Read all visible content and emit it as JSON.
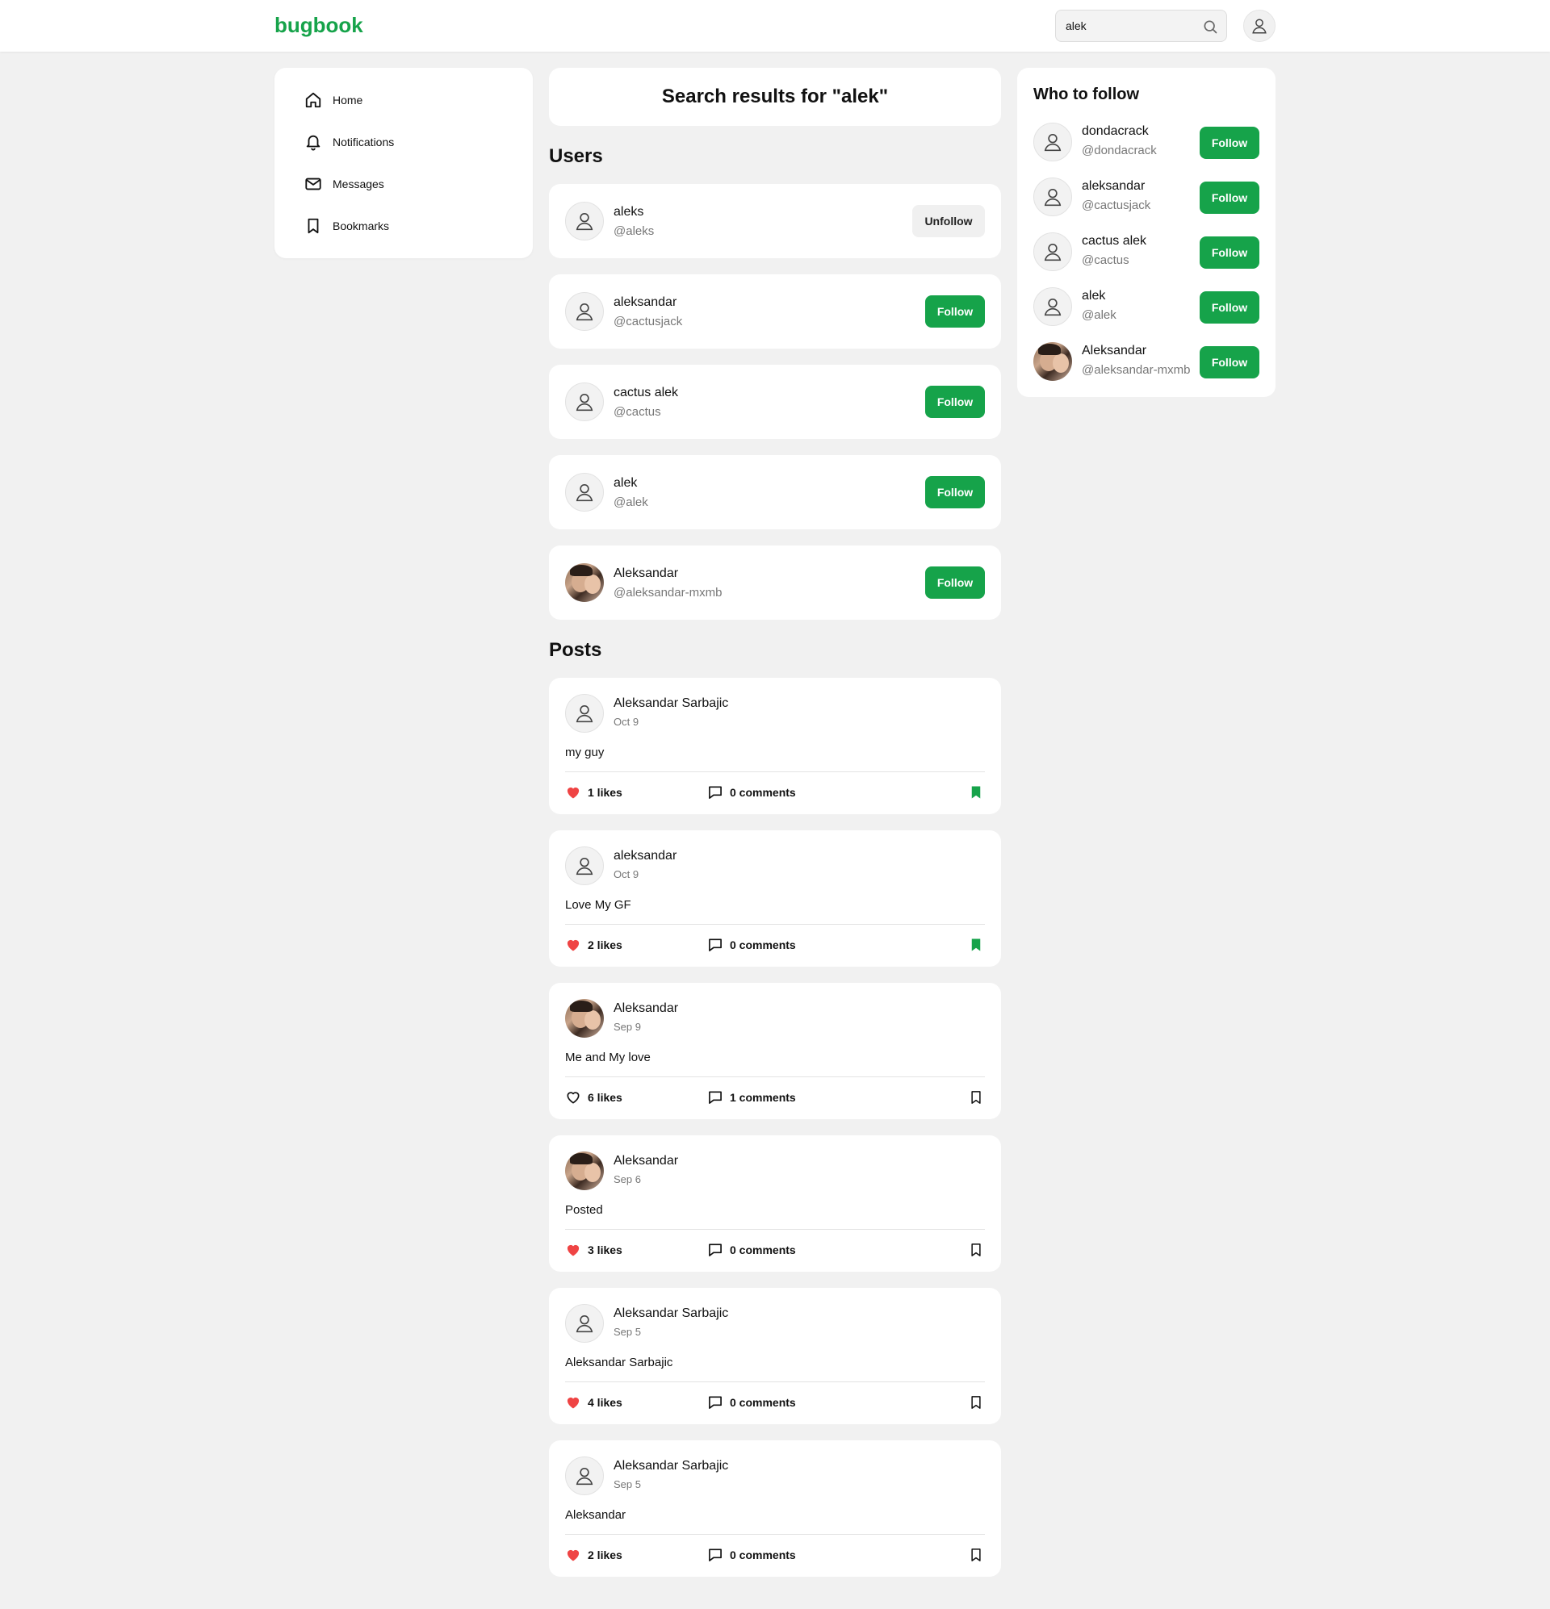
{
  "header": {
    "logo": "bugbook",
    "search_value": "alek",
    "search_icon": "search-icon",
    "avatar_icon": "user-icon"
  },
  "sidebar": {
    "items": [
      {
        "label": "Home",
        "icon": "home-icon"
      },
      {
        "label": "Notifications",
        "icon": "bell-icon"
      },
      {
        "label": "Messages",
        "icon": "mail-icon"
      },
      {
        "label": "Bookmarks",
        "icon": "bookmark-icon"
      }
    ]
  },
  "main": {
    "title": "Search results for \"alek\"",
    "users_heading": "Users",
    "posts_heading": "Posts",
    "users": [
      {
        "name": "aleks",
        "handle": "@aleks",
        "button": "Unfollow",
        "photo": false
      },
      {
        "name": "aleksandar",
        "handle": "@cactusjack",
        "button": "Follow",
        "photo": false
      },
      {
        "name": "cactus alek",
        "handle": "@cactus",
        "button": "Follow",
        "photo": false
      },
      {
        "name": "alek",
        "handle": "@alek",
        "button": "Follow",
        "photo": false
      },
      {
        "name": "Aleksandar",
        "handle": "@aleksandar-mxmb",
        "button": "Follow",
        "photo": true
      }
    ],
    "posts": [
      {
        "author": "Aleksandar Sarbajic",
        "date": "Oct 9",
        "body": "my guy",
        "likes": "1 likes",
        "liked": true,
        "comments": "0 comments",
        "bookmarked": true,
        "photo": false
      },
      {
        "author": "aleksandar",
        "date": "Oct 9",
        "body": "Love My GF",
        "likes": "2 likes",
        "liked": true,
        "comments": "0 comments",
        "bookmarked": true,
        "photo": false
      },
      {
        "author": "Aleksandar",
        "date": "Sep 9",
        "body": "Me and My love",
        "likes": "6 likes",
        "liked": false,
        "comments": "1 comments",
        "bookmarked": false,
        "photo": true
      },
      {
        "author": "Aleksandar",
        "date": "Sep 6",
        "body": "Posted",
        "likes": "3 likes",
        "liked": true,
        "comments": "0 comments",
        "bookmarked": false,
        "photo": true
      },
      {
        "author": "Aleksandar Sarbajic",
        "date": "Sep 5",
        "body": "Aleksandar Sarbajic",
        "likes": "4 likes",
        "liked": true,
        "comments": "0 comments",
        "bookmarked": false,
        "photo": false
      },
      {
        "author": "Aleksandar Sarbajic",
        "date": "Sep 5",
        "body": "Aleksandar",
        "likes": "2 likes",
        "liked": true,
        "comments": "0 comments",
        "bookmarked": false,
        "photo": false
      }
    ]
  },
  "who_to_follow": {
    "title": "Who to follow",
    "users": [
      {
        "name": "dondacrack",
        "handle": "@dondacrack",
        "button": "Follow",
        "photo": false
      },
      {
        "name": "aleksandar",
        "handle": "@cactusjack",
        "button": "Follow",
        "photo": false
      },
      {
        "name": "cactus alek",
        "handle": "@cactus",
        "button": "Follow",
        "photo": false
      },
      {
        "name": "alek",
        "handle": "@alek",
        "button": "Follow",
        "photo": false
      },
      {
        "name": "Aleksandar",
        "handle": "@aleksandar-mxmb",
        "button": "Follow",
        "photo": true
      }
    ]
  },
  "colors": {
    "brand": "#16a34a",
    "like": "#ef4444",
    "background": "#f1f1f1"
  }
}
